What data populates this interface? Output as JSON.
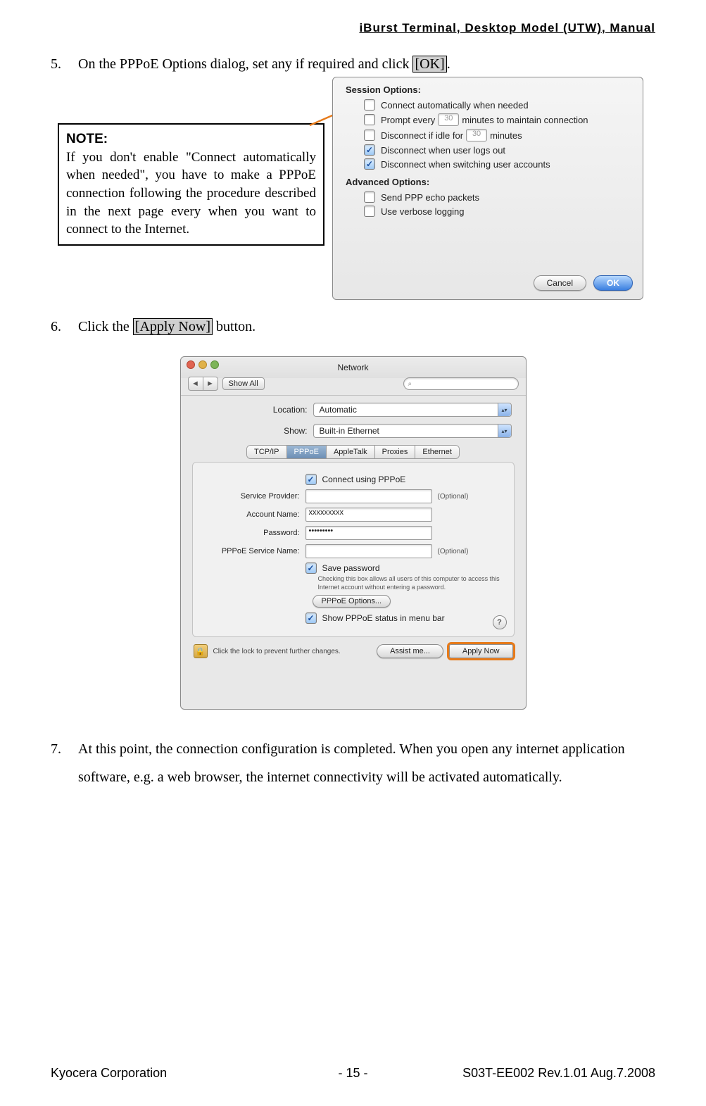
{
  "header": {
    "title": "iBurst Terminal, Desktop Model (UTW), Manual"
  },
  "step5": {
    "num": "5.",
    "text_before": "On the PPPoE Options dialog, set any if required and click ",
    "button": "[OK]",
    "text_after": "."
  },
  "note": {
    "title": "NOTE:",
    "body": "If you don't enable \"Connect automatically when needed\", you have to make a PPPoE connection following the procedure described in the next page every when you want to connect to the Internet."
  },
  "dialog1": {
    "session_hdr": "Session Options:",
    "opt1": "Connect automatically when needed",
    "opt2a": "Prompt every",
    "opt2_val": "30",
    "opt2b": "minutes to maintain connection",
    "opt3a": "Disconnect if idle for",
    "opt3_val": "30",
    "opt3b": "minutes",
    "opt4": "Disconnect when user logs out",
    "opt5": "Disconnect when switching user accounts",
    "adv_hdr": "Advanced Options:",
    "opt6": "Send PPP echo packets",
    "opt7": "Use verbose logging",
    "cancel": "Cancel",
    "ok": "OK"
  },
  "step6": {
    "num": "6.",
    "text_before": "Click the ",
    "button": "[Apply Now]",
    "text_after": " button."
  },
  "dialog2": {
    "title": "Network",
    "showall": "Show All",
    "back": "◄",
    "fwd": "►",
    "search_ic": "⌕",
    "loc_lbl": "Location:",
    "loc_val": "Automatic",
    "show_lbl": "Show:",
    "show_val": "Built-in Ethernet",
    "tabs": {
      "t1": "TCP/IP",
      "t2": "PPPoE",
      "t3": "AppleTalk",
      "t4": "Proxies",
      "t5": "Ethernet"
    },
    "connect_chk": "Connect using PPPoE",
    "sp_lbl": "Service Provider:",
    "sp_opt": "(Optional)",
    "an_lbl": "Account Name:",
    "an_val": "xxxxxxxxx",
    "pw_lbl": "Password:",
    "pw_val": "•••••••••",
    "sn_lbl": "PPPoE Service Name:",
    "sn_opt": "(Optional)",
    "save_chk": "Save password",
    "save_hint": "Checking this box allows all users of this computer to access this Internet account without entering a password.",
    "pppoe_opts": "PPPoE Options...",
    "show_status": "Show PPPoE status in menu bar",
    "help": "?",
    "lock_ic": "🔒",
    "lock_txt": "Click the lock to prevent further changes.",
    "assist": "Assist me...",
    "apply": "Apply Now"
  },
  "step7": {
    "num": "7.",
    "text": "At this point, the connection configuration is completed. When you open any internet application software, e.g. a web browser, the internet connectivity will be activated automatically."
  },
  "footer": {
    "left": "Kyocera Corporation",
    "center": "- 15 -",
    "right": "S03T-EE002 Rev.1.01 Aug.7.2008"
  }
}
